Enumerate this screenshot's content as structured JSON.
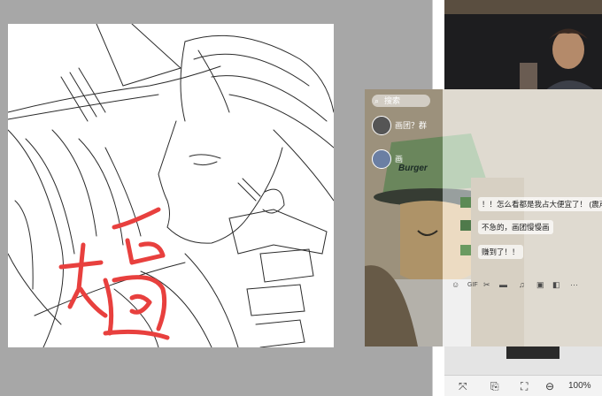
{
  "canvas": {
    "signature_text": "楊"
  },
  "chat": {
    "search_placeholder": "搜索",
    "conversations": [
      {
        "name": "画团？群"
      },
      {
        "name": "画"
      }
    ],
    "messages": [
      {
        "text": "！！怎么看都是我占大便宜了！ (震声"
      },
      {
        "text": "不急的，画团慢慢画"
      },
      {
        "text": "赚到了！！"
      }
    ],
    "toolbar_icons": [
      "emoji-icon",
      "gif-icon",
      "scissors-icon",
      "folder-icon",
      "music-icon",
      "image-icon",
      "more-icon"
    ],
    "toolbar_more": "···",
    "burger_label": "Burger"
  },
  "viewer": {
    "zoom": "100%"
  },
  "colors": {
    "background": "#a7a7a7",
    "canvas": "#ffffff",
    "signature": "#e8403e",
    "sketch_line": "#2b2b2b"
  }
}
